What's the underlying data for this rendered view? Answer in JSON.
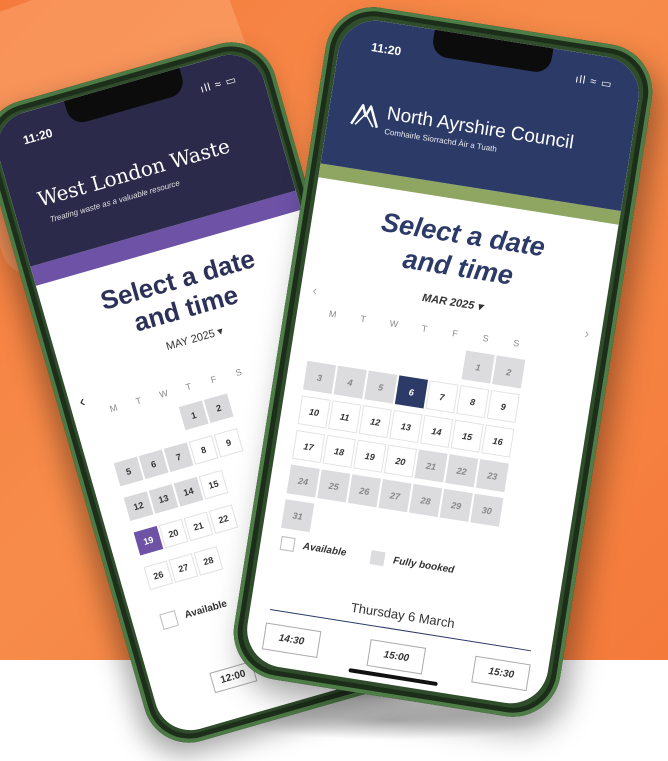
{
  "back_phone": {
    "status_time": "11:20",
    "status_icons": "ıll ≈ ▭",
    "brand_name": "West London Waste",
    "tagline": "Treating waste as a valuable resource",
    "title": "Select a date and time",
    "title_line1": "Select a date",
    "title_line2": "and time",
    "month_label": "MAY 2025 ▾",
    "prev_icon": "‹",
    "weekdays": [
      "M",
      "T",
      "W",
      "T",
      "F",
      "S"
    ],
    "days": [
      "1",
      "2",
      "5",
      "6",
      "7",
      "8",
      "9",
      "12",
      "13",
      "14",
      "15",
      "19",
      "20",
      "21",
      "22",
      "26",
      "27",
      "28"
    ],
    "selected_day": "19",
    "legend_available": "Available",
    "time_slot": "12:00",
    "accent_color": "#6d52a6",
    "header_color": "#2b2a4a"
  },
  "front_phone": {
    "status_time": "11:20",
    "status_icons": "ıll ≈ ▭",
    "council_name": "North Ayrshire Council",
    "council_subtitle": "Comhairle Siorrachd Àir a Tuath",
    "title": "Select a date and time",
    "title_line1": "Select a date",
    "title_line2": "and time",
    "month_label": "MAR 2025 ▾",
    "prev_icon": "‹",
    "next_icon": "›",
    "weekdays": [
      "M",
      "T",
      "W",
      "T",
      "F",
      "S",
      "S"
    ],
    "days": [
      "1",
      "2",
      "3",
      "4",
      "5",
      "6",
      "7",
      "8",
      "9",
      "10",
      "11",
      "12",
      "13",
      "14",
      "15",
      "16",
      "17",
      "18",
      "19",
      "20",
      "21",
      "22",
      "23",
      "24",
      "25",
      "26",
      "27",
      "28",
      "29",
      "30",
      "31"
    ],
    "selected_day": "6",
    "legend_available": "Available",
    "legend_fully_booked": "Fully booked",
    "selected_date_text": "Thursday 6 March",
    "time_slots": [
      "14:30",
      "15:00",
      "15:30"
    ],
    "accent_color": "#2c3a67",
    "header_color": "#2c3a67",
    "stripe_color": "#8fa562"
  }
}
